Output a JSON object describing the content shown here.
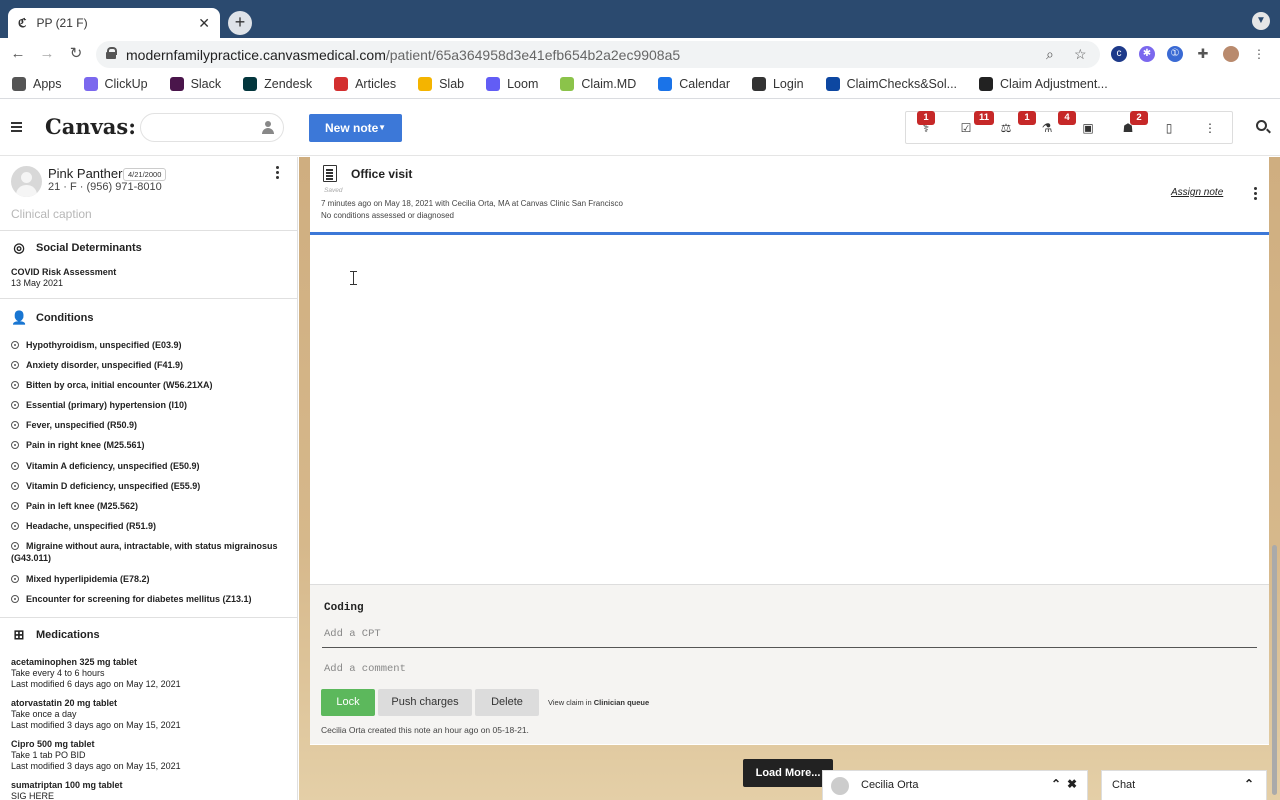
{
  "browser": {
    "tab_title": "PP (21 F)",
    "tab_favicon": "ℭ",
    "url_host": "modernfamilypractice.canvasmedical.com",
    "url_path": "/patient/65a364958d3e41efb654b2a2ec9908a5",
    "ext_badge": "9+"
  },
  "bookmarks": [
    {
      "label": "Apps",
      "icon": "apps-grid-icon",
      "color": "#555555"
    },
    {
      "label": "ClickUp",
      "icon": "clickup-icon",
      "color": "#7b68ee"
    },
    {
      "label": "Slack",
      "icon": "slack-icon",
      "color": "#4a154b"
    },
    {
      "label": "Zendesk",
      "icon": "zendesk-icon",
      "color": "#03363d"
    },
    {
      "label": "Articles",
      "icon": "articles-icon",
      "color": "#d32f2f"
    },
    {
      "label": "Slab",
      "icon": "slab-icon",
      "color": "#f4b400"
    },
    {
      "label": "Loom",
      "icon": "loom-icon",
      "color": "#625df5"
    },
    {
      "label": "Claim.MD",
      "icon": "claimmd-icon",
      "color": "#8bc34a"
    },
    {
      "label": "Calendar",
      "icon": "calendar-icon",
      "color": "#1a73e8"
    },
    {
      "label": "Login",
      "icon": "canvas-icon",
      "color": "#333333"
    },
    {
      "label": "ClaimChecks&Sol...",
      "icon": "claimchecks-icon",
      "color": "#0d47a1"
    },
    {
      "label": "Claim Adjustment...",
      "icon": "claim-adjustment-icon",
      "color": "#222222"
    }
  ],
  "app": {
    "logo": "Canvas:",
    "new_note_label": "New note",
    "toolbar_badges": [
      "1",
      "11",
      "1",
      "4",
      "2"
    ]
  },
  "patient": {
    "name": "Pink Panther",
    "dob": "4/21/2000",
    "info": "21 · F · (956) 971-8010",
    "caption_placeholder": "Clinical caption"
  },
  "sections": {
    "social_title": "Social Determinants",
    "covid_title": "COVID Risk Assessment",
    "covid_date": "13 May 2021",
    "conditions_title": "Conditions",
    "medications_title": "Medications"
  },
  "conditions": [
    "Hypothyroidism, unspecified (E03.9)",
    "Anxiety disorder, unspecified (F41.9)",
    "Bitten by orca, initial encounter (W56.21XA)",
    "Essential (primary) hypertension (I10)",
    "Fever, unspecified (R50.9)",
    "Pain in right knee (M25.561)",
    "Vitamin A deficiency, unspecified (E50.9)",
    "Vitamin D deficiency, unspecified (E55.9)",
    "Pain in left knee (M25.562)",
    "Headache, unspecified (R51.9)",
    "Migraine without aura, intractable, with status migrainosus (G43.011)",
    "Mixed hyperlipidemia (E78.2)",
    "Encounter for screening for diabetes mellitus (Z13.1)"
  ],
  "medications": [
    {
      "name": "acetaminophen 325 mg tablet",
      "sig": "Take every 4 to 6 hours",
      "modified": "Last modified 6 days ago on May 12, 2021"
    },
    {
      "name": "atorvastatin 20 mg tablet",
      "sig": "Take once a day",
      "modified": "Last modified 3 days ago on May 15, 2021"
    },
    {
      "name": "Cipro 500 mg tablet",
      "sig": "Take 1 tab PO BID",
      "modified": "Last modified 3 days ago on May 15, 2021"
    },
    {
      "name": "sumatriptan 100 mg tablet",
      "sig": "SIG HERE",
      "modified": ""
    }
  ],
  "note": {
    "title": "Office visit",
    "saved": "Saved",
    "meta_line1": "7 minutes ago on May 18, 2021 with Cecilia Orta, MA at Canvas Clinic San Francisco",
    "meta_line2": "No conditions assessed or diagnosed",
    "assign_label": "Assign note",
    "coding_label": "Coding",
    "cpt_placeholder": "Add a CPT",
    "comment_placeholder": "Add a comment",
    "lock_label": "Lock",
    "push_label": "Push charges",
    "delete_label": "Delete",
    "view_claim_prefix": "View claim in",
    "view_claim_queue": "Clinician queue",
    "creator": "Cecilia Orta created this note an hour ago on 05-18-21."
  },
  "footer": {
    "load_more": "Load More...",
    "chat_user": "Cecilia Orta",
    "chat_label": "Chat"
  },
  "colors": {
    "primary": "#3c78d8",
    "lock_green": "#5cb85c",
    "badge_red": "#c62828",
    "browser_frame": "#2b4a6f"
  }
}
